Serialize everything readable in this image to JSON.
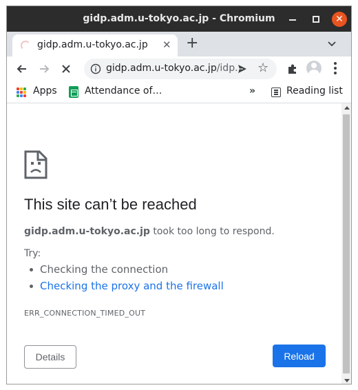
{
  "window": {
    "title": "gidp.adm.u-tokyo.ac.jp - Chromium"
  },
  "tab": {
    "title": "gidp.adm.u-tokyo.ac.jp",
    "close_glyph": "✕"
  },
  "toolbar": {
    "url_host": "gidp.adm.u-tokyo.ac.jp",
    "url_path": "/idp...",
    "star_glyph": "☆"
  },
  "bookmarks": {
    "apps_label": "Apps",
    "item_label": "Attendance of…",
    "more_glyph": "»",
    "reading_list_label": "Reading list"
  },
  "error_page": {
    "heading": "This site can’t be reached",
    "host": "gidp.adm.u-tokyo.ac.jp",
    "message": " took too long to respond.",
    "try_label": "Try:",
    "suggestions": [
      "Checking the connection",
      "Checking the proxy and the firewall"
    ],
    "error_code": "ERR_CONNECTION_TIMED_OUT",
    "details_button": "Details",
    "reload_button": "Reload"
  },
  "colors": {
    "titlebar": "#2c2c2c",
    "close_button": "#e95420",
    "link": "#1a73e8",
    "reload_button": "#1a73e8",
    "text_secondary": "#5f6368"
  },
  "icons": {
    "window_close": "close-icon",
    "tab_loading": "loading-spinner-icon",
    "nav_back": "back-arrow-icon",
    "nav_forward": "forward-arrow-icon",
    "stop": "stop-icon",
    "site_info": "info-icon",
    "share": "send-icon",
    "bookmark": "star-icon",
    "extensions": "puzzle-icon",
    "profile": "avatar-icon",
    "menu": "kebab-menu-icon",
    "page_error": "sad-page-icon"
  }
}
